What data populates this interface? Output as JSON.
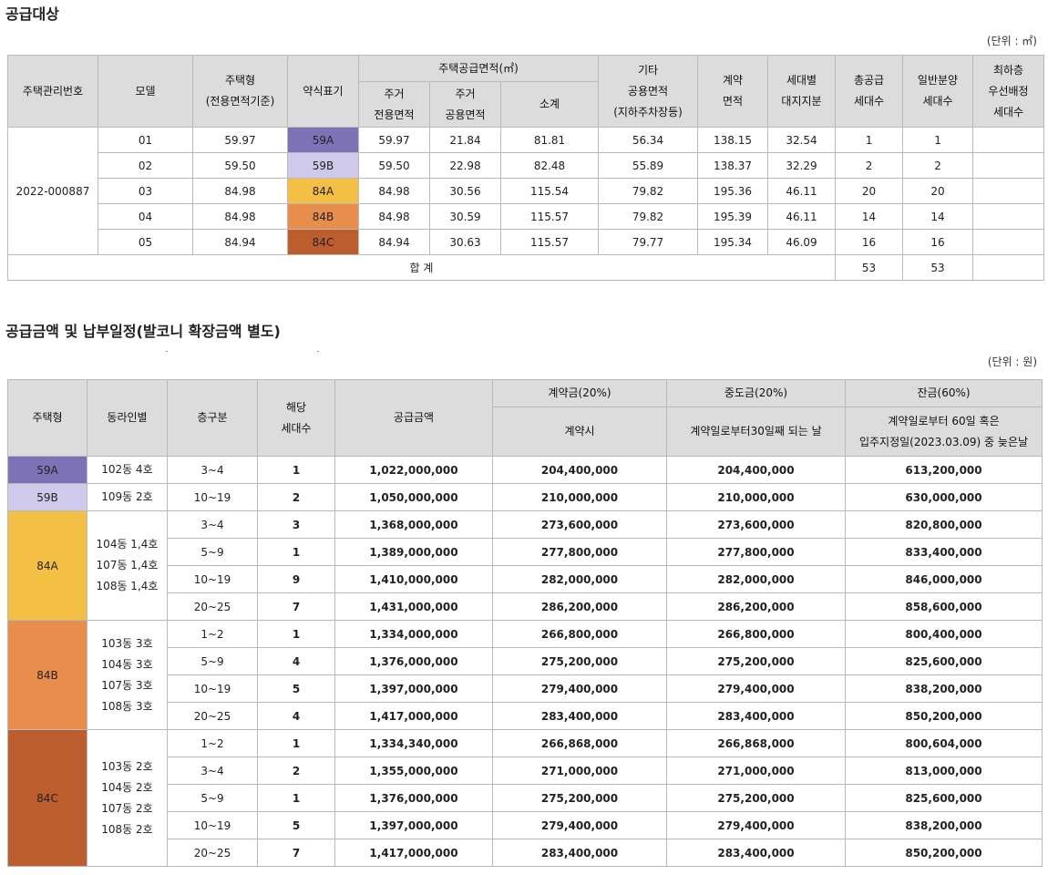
{
  "section1": {
    "title": "공급대상",
    "unit": "(단위 : ㎡)",
    "headers": {
      "mgmt_no": "주택관리번호",
      "model": "모델",
      "type": "주택형\n(전용면적기준)",
      "abbr": "약식표기",
      "supply_area": "주택공급면적(㎡)",
      "excl": "주거\n전용면적",
      "common": "주거\n공용면적",
      "subtotal": "소계",
      "other_common": "기타\n공용면적\n(지하주차장등)",
      "contract_area": "계약\n면적",
      "land_share": "세대별\n대지지분",
      "total_units": "총공급\n세대수",
      "general_units": "일반분양\n세대수",
      "top_floor": "최하층\n우선배정\n세대수"
    },
    "mgmt_no": "2022-000887",
    "rows": [
      {
        "model": "01",
        "type": "59.97",
        "abbr": "59A",
        "excl": "59.97",
        "common": "21.84",
        "subtotal": "81.81",
        "other": "56.34",
        "contract": "138.15",
        "land": "32.54",
        "total": "1",
        "general": "1",
        "top": ""
      },
      {
        "model": "02",
        "type": "59.50",
        "abbr": "59B",
        "excl": "59.50",
        "common": "22.98",
        "subtotal": "82.48",
        "other": "55.89",
        "contract": "138.37",
        "land": "32.29",
        "total": "2",
        "general": "2",
        "top": ""
      },
      {
        "model": "03",
        "type": "84.98",
        "abbr": "84A",
        "excl": "84.98",
        "common": "30.56",
        "subtotal": "115.54",
        "other": "79.82",
        "contract": "195.36",
        "land": "46.11",
        "total": "20",
        "general": "20",
        "top": ""
      },
      {
        "model": "04",
        "type": "84.98",
        "abbr": "84B",
        "excl": "84.98",
        "common": "30.59",
        "subtotal": "115.57",
        "other": "79.82",
        "contract": "195.39",
        "land": "46.11",
        "total": "14",
        "general": "14",
        "top": ""
      },
      {
        "model": "05",
        "type": "84.94",
        "abbr": "84C",
        "excl": "84.94",
        "common": "30.63",
        "subtotal": "115.57",
        "other": "79.77",
        "contract": "195.34",
        "land": "46.09",
        "total": "16",
        "general": "16",
        "top": ""
      }
    ],
    "total_row": {
      "label": "합 계",
      "total": "53",
      "general": "53",
      "top": ""
    }
  },
  "section2": {
    "title": "공급금액 및 납부일정(발코니 확장금액 별도)",
    "unit": "(단위 : 원)",
    "headers": {
      "type": "주택형",
      "line": "동라인별",
      "floor": "층구분",
      "units": "해당\n세대수",
      "price": "공급금액",
      "deposit": "계약금(20%)",
      "deposit_sub": "계약시",
      "middle": "중도금(20%)",
      "middle_sub": "계약일로부터30일째 되는 날",
      "balance": "잔금(60%)",
      "balance_sub": "계약일로부터 60일 혹은\n입주지정일(2023.03.09) 중 늦은날"
    },
    "groups": [
      {
        "type": "59A",
        "lines": "102동 4호",
        "rows": [
          {
            "floor": "3~4",
            "units": "1",
            "price": "1,022,000,000",
            "deposit": "204,400,000",
            "middle": "204,400,000",
            "balance": "613,200,000"
          }
        ]
      },
      {
        "type": "59B",
        "lines": "109동 2호",
        "rows": [
          {
            "floor": "10~19",
            "units": "2",
            "price": "1,050,000,000",
            "deposit": "210,000,000",
            "middle": "210,000,000",
            "balance": "630,000,000"
          }
        ]
      },
      {
        "type": "84A",
        "lines": "104동 1,4호\n107동 1,4호\n108동 1,4호",
        "rows": [
          {
            "floor": "3~4",
            "units": "3",
            "price": "1,368,000,000",
            "deposit": "273,600,000",
            "middle": "273,600,000",
            "balance": "820,800,000"
          },
          {
            "floor": "5~9",
            "units": "1",
            "price": "1,389,000,000",
            "deposit": "277,800,000",
            "middle": "277,800,000",
            "balance": "833,400,000"
          },
          {
            "floor": "10~19",
            "units": "9",
            "price": "1,410,000,000",
            "deposit": "282,000,000",
            "middle": "282,000,000",
            "balance": "846,000,000"
          },
          {
            "floor": "20~25",
            "units": "7",
            "price": "1,431,000,000",
            "deposit": "286,200,000",
            "middle": "286,200,000",
            "balance": "858,600,000"
          }
        ]
      },
      {
        "type": "84B",
        "lines": "103동 3호\n104동 3호\n107동 3호\n108동 3호",
        "rows": [
          {
            "floor": "1~2",
            "units": "1",
            "price": "1,334,000,000",
            "deposit": "266,800,000",
            "middle": "266,800,000",
            "balance": "800,400,000"
          },
          {
            "floor": "5~9",
            "units": "4",
            "price": "1,376,000,000",
            "deposit": "275,200,000",
            "middle": "275,200,000",
            "balance": "825,600,000"
          },
          {
            "floor": "10~19",
            "units": "5",
            "price": "1,397,000,000",
            "deposit": "279,400,000",
            "middle": "279,400,000",
            "balance": "838,200,000"
          },
          {
            "floor": "20~25",
            "units": "4",
            "price": "1,417,000,000",
            "deposit": "283,400,000",
            "middle": "283,400,000",
            "balance": "850,200,000"
          }
        ]
      },
      {
        "type": "84C",
        "lines": "103동 2호\n104동 2호\n107동 2호\n108동 2호",
        "rows": [
          {
            "floor": "1~2",
            "units": "1",
            "price": "1,334,340,000",
            "deposit": "266,868,000",
            "middle": "266,868,000",
            "balance": "800,604,000"
          },
          {
            "floor": "3~4",
            "units": "2",
            "price": "1,355,000,000",
            "deposit": "271,000,000",
            "middle": "271,000,000",
            "balance": "813,000,000"
          },
          {
            "floor": "5~9",
            "units": "1",
            "price": "1,376,000,000",
            "deposit": "275,200,000",
            "middle": "275,200,000",
            "balance": "825,600,000"
          },
          {
            "floor": "10~19",
            "units": "5",
            "price": "1,397,000,000",
            "deposit": "279,400,000",
            "middle": "279,400,000",
            "balance": "838,200,000"
          },
          {
            "floor": "20~25",
            "units": "7",
            "price": "1,417,000,000",
            "deposit": "283,400,000",
            "middle": "283,400,000",
            "balance": "850,200,000"
          }
        ]
      }
    ],
    "colors": {
      "59A": "#7d72b5",
      "59B": "#cfc9ec",
      "84A": "#f3bf45",
      "84B": "#e78e4d",
      "84C": "#bb5d2d"
    }
  }
}
